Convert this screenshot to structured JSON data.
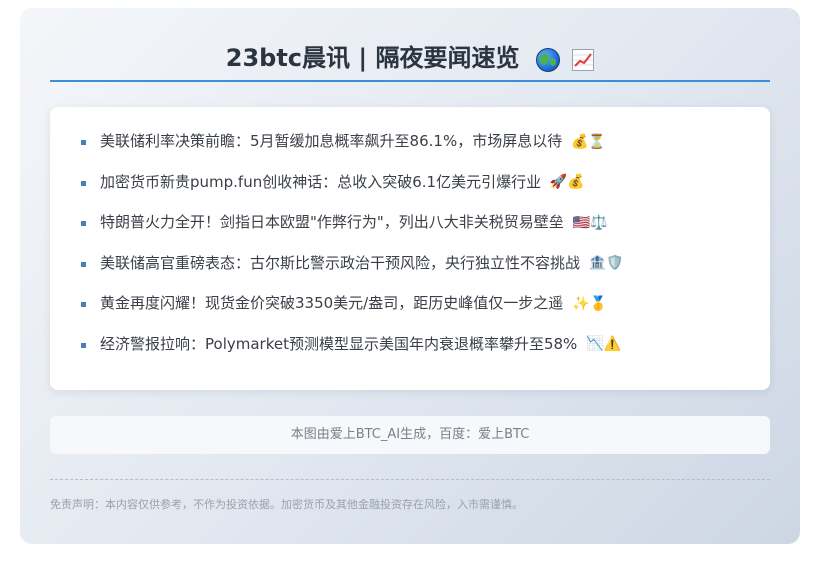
{
  "header": {
    "title": "23btc晨讯 | 隔夜要闻速览",
    "icons": [
      "globe-icon",
      "chart-increasing-icon"
    ]
  },
  "news": [
    {
      "text": "美联储利率决策前瞻：5月暂缓加息概率飙升至86.1%，市场屏息以待",
      "emoji": "💰⏳"
    },
    {
      "text": "加密货币新贵pump.fun创收神话：总收入突破6.1亿美元引爆行业",
      "emoji": "🚀💰"
    },
    {
      "text": "特朗普火力全开！剑指日本欧盟\"作弊行为\"，列出八大非关税贸易壁垒",
      "emoji": "🇺🇸⚖️"
    },
    {
      "text": "美联储高官重磅表态：古尔斯比警示政治干预风险，央行独立性不容挑战",
      "emoji": "🏦🛡️"
    },
    {
      "text": "黄金再度闪耀！现货金价突破3350美元/盎司，距历史峰值仅一步之遥",
      "emoji": "✨🥇"
    },
    {
      "text": "经济警报拉响：Polymarket预测模型显示美国年内衰退概率攀升至58%",
      "emoji": "📉⚠️"
    }
  ],
  "footer": {
    "credit": "本图由爱上BTC_AI生成，百度：爱上BTC",
    "disclaimer": "免责声明：本内容仅供参考，不作为投资依据。加密货币及其他金融投资存在风险，入市需谨慎。"
  }
}
